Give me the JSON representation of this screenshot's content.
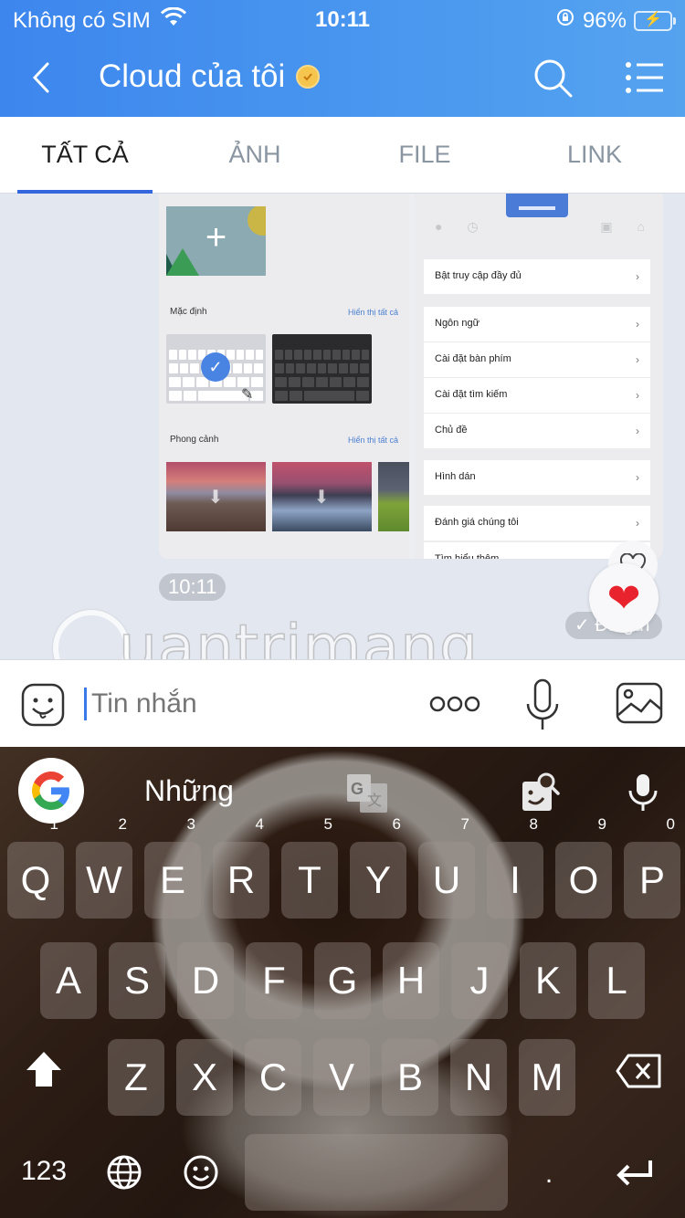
{
  "status_bar": {
    "carrier": "Không có SIM",
    "time": "10:11",
    "battery_percent": "96%",
    "battery_level": 0.96,
    "charging": true
  },
  "navbar": {
    "title": "Cloud của tôi",
    "verified": true
  },
  "tabs": [
    {
      "label": "TẤT CẢ",
      "active": true
    },
    {
      "label": "ẢNH",
      "active": false
    },
    {
      "label": "FILE",
      "active": false
    },
    {
      "label": "LINK",
      "active": false
    }
  ],
  "shared_screenshot": {
    "left_panel": {
      "section_default": "Mặc định",
      "section_default_link": "Hiển thị tất cả",
      "section_landscape": "Phong cảnh",
      "section_landscape_link": "Hiển thị tất cả"
    },
    "right_panel": {
      "items": [
        "Bật truy cập đầy đủ",
        "Ngôn ngữ",
        "Cài đặt bàn phím",
        "Cài đặt tìm kiếm",
        "Chủ đề",
        "Hình dán",
        "Đánh giá chúng tôi",
        "Tìm hiểu thêm"
      ]
    }
  },
  "message_meta": {
    "time": "10:11",
    "status": "Đã gửi",
    "reaction": "❤"
  },
  "watermark": "uantrimang",
  "composer": {
    "placeholder": "Tin nhắn",
    "value": ""
  },
  "keyboard": {
    "suggestion": "Những",
    "row1": [
      {
        "key": "Q",
        "num": "1"
      },
      {
        "key": "W",
        "num": "2"
      },
      {
        "key": "E",
        "num": "3"
      },
      {
        "key": "R",
        "num": "4"
      },
      {
        "key": "T",
        "num": "5"
      },
      {
        "key": "Y",
        "num": "6"
      },
      {
        "key": "U",
        "num": "7"
      },
      {
        "key": "I",
        "num": "8"
      },
      {
        "key": "O",
        "num": "9"
      },
      {
        "key": "P",
        "num": "0"
      }
    ],
    "row2": [
      "A",
      "S",
      "D",
      "F",
      "G",
      "H",
      "J",
      "K",
      "L"
    ],
    "row3": [
      "Z",
      "X",
      "C",
      "V",
      "B",
      "N",
      "M"
    ],
    "numbers_label": "123",
    "period_label": "."
  }
}
